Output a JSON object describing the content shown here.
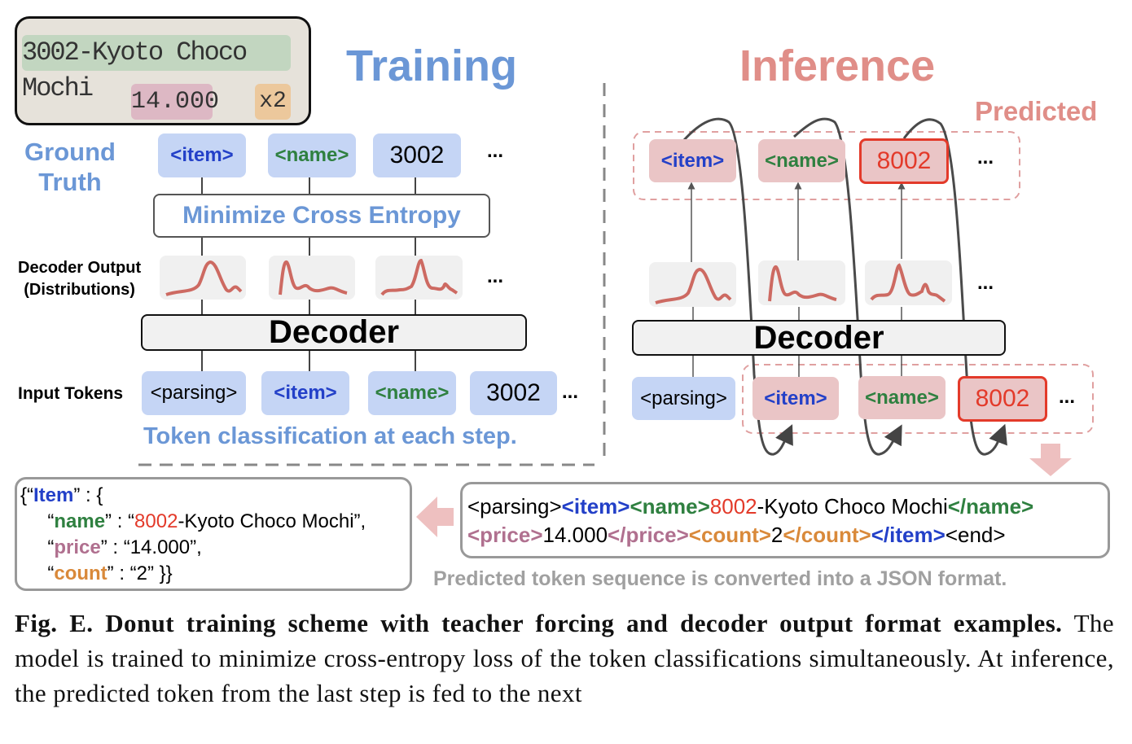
{
  "receipt": {
    "name_text": "3002-Kyoto Choco Mochi",
    "price_text": "14.000",
    "count_text": "x2"
  },
  "training": {
    "title": "Training",
    "ground_truth_label": [
      "Ground",
      "Truth"
    ],
    "gt_tokens": [
      "<item>",
      "<name>",
      "3002",
      "..."
    ],
    "loss_label": "Minimize Cross Entropy",
    "decoder_output_label": [
      "Decoder Output",
      "(Distributions)"
    ],
    "dist_ellipsis": "...",
    "decoder_label": "Decoder",
    "input_tokens_label": "Input Tokens",
    "input_tokens": [
      "<parsing>",
      "<item>",
      "<name>",
      "3002",
      "..."
    ],
    "note": "Token classification at each step."
  },
  "inference": {
    "title": "Inference",
    "predicted_label": "Predicted",
    "pred_tokens": [
      "<item>",
      "<name>",
      "8002",
      "..."
    ],
    "dist_ellipsis": "...",
    "decoder_label": "Decoder",
    "input_tokens": [
      "<parsing>",
      "<item>",
      "<name>",
      "8002",
      "..."
    ]
  },
  "sequence": {
    "line1": [
      {
        "t": "<parsing>",
        "c": ""
      },
      {
        "t": "<item>",
        "c": "item"
      },
      {
        "t": "<name>",
        "c": "name"
      },
      {
        "t": "8002",
        "c": "red"
      },
      {
        "t": "-Kyoto Choco Mochi",
        "c": ""
      },
      {
        "t": "</name>",
        "c": "name"
      }
    ],
    "line2": [
      {
        "t": "<price>",
        "c": "price"
      },
      {
        "t": "14.000",
        "c": ""
      },
      {
        "t": "</price>",
        "c": "price"
      },
      {
        "t": "<count>",
        "c": "count"
      },
      {
        "t": "2",
        "c": ""
      },
      {
        "t": "</count>",
        "c": "count"
      },
      {
        "t": "</item>",
        "c": "item"
      },
      {
        "t": "<end>",
        "c": ""
      }
    ],
    "note": "Predicted token sequence is converted into a JSON format."
  },
  "json": {
    "lines": [
      [
        {
          "t": "{“",
          "c": ""
        },
        {
          "t": "Item",
          "c": "item"
        },
        {
          "t": "” : {",
          "c": ""
        }
      ],
      [
        {
          "t": "     “",
          "c": ""
        },
        {
          "t": "name",
          "c": "name"
        },
        {
          "t": "” : “",
          "c": ""
        },
        {
          "t": "8002",
          "c": "red"
        },
        {
          "t": "-Kyoto Choco Mochi”,",
          "c": ""
        }
      ],
      [
        {
          "t": "     “",
          "c": ""
        },
        {
          "t": "price",
          "c": "price"
        },
        {
          "t": "” : “14.000”,",
          "c": ""
        }
      ],
      [
        {
          "t": "     “",
          "c": ""
        },
        {
          "t": "count",
          "c": "count"
        },
        {
          "t": "” : “2” }}",
          "c": ""
        }
      ]
    ]
  },
  "caption": {
    "bold": "Fig. E. Donut training scheme with teacher forcing and decoder output format examples.",
    "text": " The model is trained to minimize cross-entropy loss of the token classifications simultaneously. At inference, the predicted token from the last step is fed to the next"
  },
  "colors": {
    "training_blue": "#6b97d6",
    "token_blue_bg": "#c5d5f5",
    "item_blue": "#2340c8",
    "name_green": "#2f8040",
    "predicted_red": "#e33a2a",
    "predicted_bg": "#eac5c6",
    "inference_pink": "#e08e88",
    "price_mauve": "#b0708f",
    "count_orange": "#d9893a"
  }
}
